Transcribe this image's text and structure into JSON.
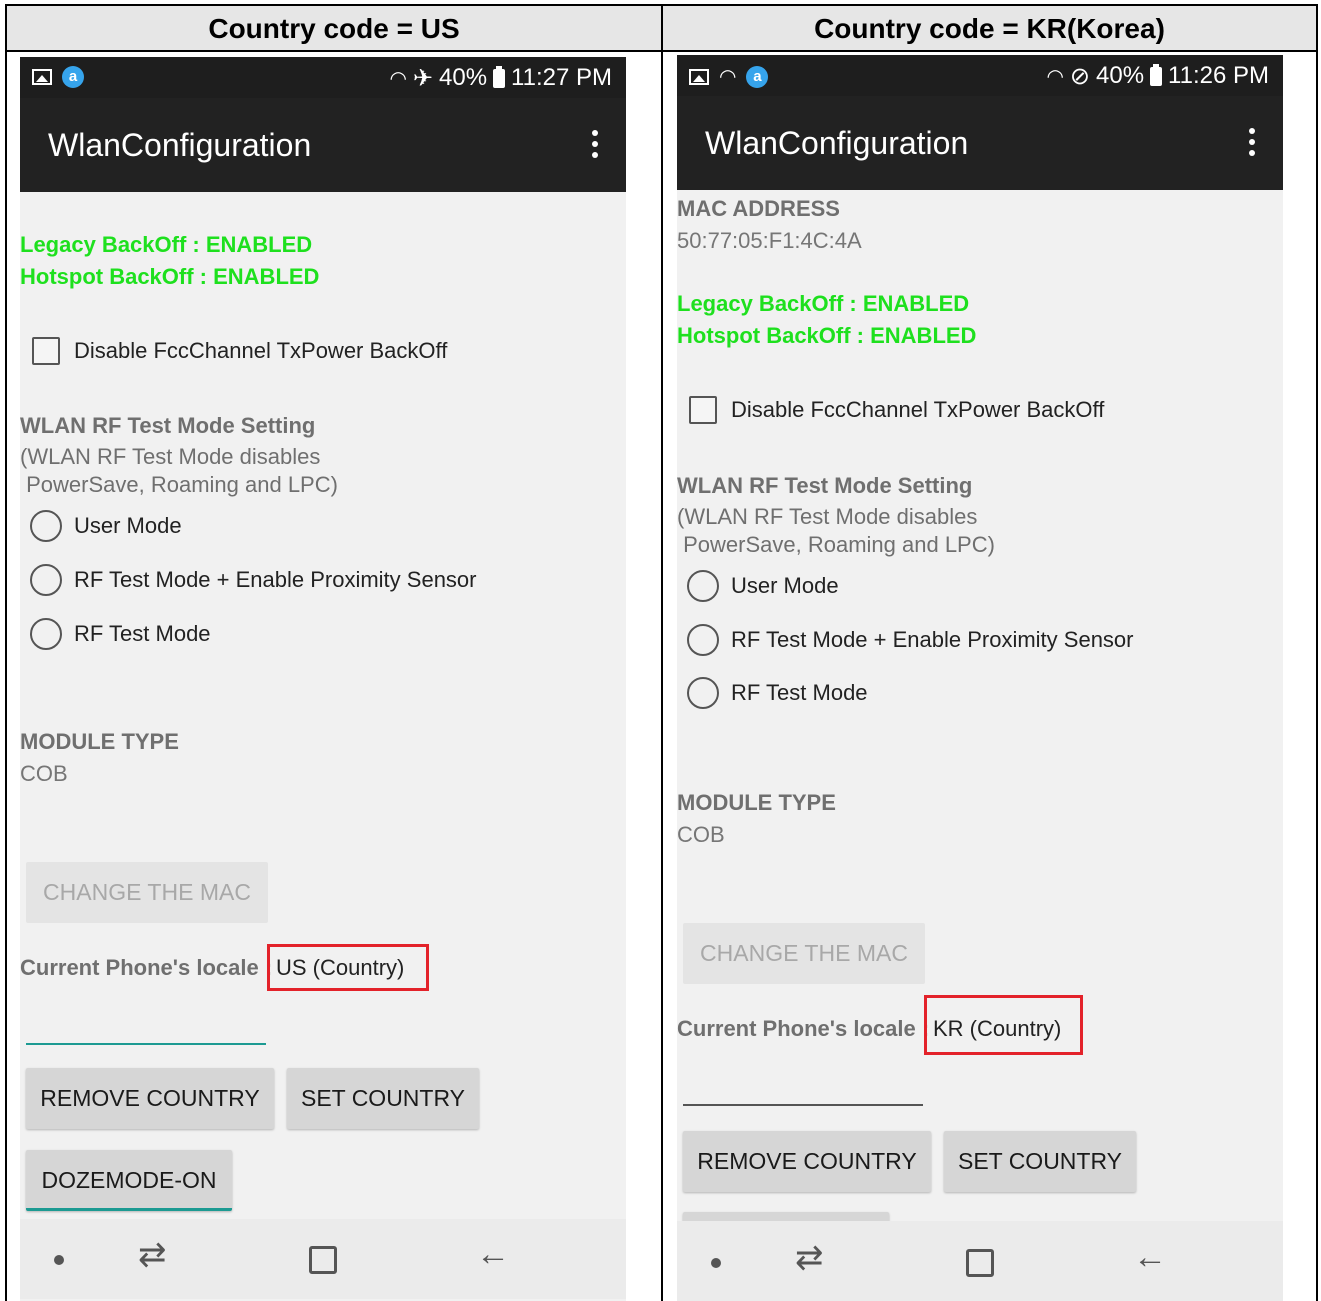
{
  "headers": {
    "left": "Country code = US",
    "right": "Country code = KR(Korea)"
  },
  "left_phone": {
    "status": {
      "battery": "40%",
      "time": "11:27 PM"
    },
    "app_title": "WlanConfiguration",
    "legacy_backoff": "Legacy BackOff : ENABLED",
    "hotspot_backoff": "Hotspot BackOff : ENABLED",
    "disable_fcc_label": "Disable FccChannel TxPower BackOff",
    "rf_mode_title": "WLAN RF Test Mode Setting",
    "rf_mode_note_1": "(WLAN RF Test Mode disables",
    "rf_mode_note_2": " PowerSave, Roaming and LPC)",
    "radio_user": "User Mode",
    "radio_rf_prox": "RF Test Mode + Enable Proximity Sensor",
    "radio_rf": "RF Test Mode",
    "module_type_label": "MODULE TYPE",
    "module_type_value": "COB",
    "change_mac": "CHANGE THE MAC",
    "locale_label": "Current Phone's locale : ",
    "locale_value": "US (Country)",
    "remove_country": "REMOVE COUNTRY",
    "set_country": "SET COUNTRY",
    "dozemode": "DOZEMODE-ON"
  },
  "right_phone": {
    "status": {
      "battery": "40%",
      "time": "11:26 PM"
    },
    "app_title": "WlanConfiguration",
    "mac_label": "MAC ADDRESS",
    "mac_value": "50:77:05:F1:4C:4A",
    "legacy_backoff": "Legacy BackOff : ENABLED",
    "hotspot_backoff": "Hotspot BackOff : ENABLED",
    "disable_fcc_label": "Disable FccChannel TxPower BackOff",
    "rf_mode_title": "WLAN RF Test Mode Setting",
    "rf_mode_note_1": "(WLAN RF Test Mode disables",
    "rf_mode_note_2": " PowerSave, Roaming and LPC)",
    "radio_user": "User Mode",
    "radio_rf_prox": "RF Test Mode + Enable Proximity Sensor",
    "radio_rf": "RF Test Mode",
    "module_type_label": "MODULE TYPE",
    "module_type_value": "COB",
    "change_mac": "CHANGE THE MAC",
    "locale_label": "Current Phone's locale : ",
    "locale_value": "KR (Country)",
    "remove_country": "REMOVE COUNTRY",
    "set_country": "SET COUNTRY"
  },
  "colors": {
    "enabled_green": "#1ee01e",
    "highlight_red": "#e3222a",
    "edit_underline_active": "#1c9a92",
    "edit_underline_inactive": "#555555",
    "appbar": "#222222"
  },
  "icons": {
    "status_left": [
      "image-icon",
      "assistant-icon"
    ],
    "status_right_us": [
      "wifi-icon",
      "airplane-icon",
      "battery-icon"
    ],
    "status_right_kr": [
      "wifi-icon",
      "do-not-disturb-icon",
      "battery-icon"
    ],
    "app_menu": "overflow-menu-icon",
    "nav": [
      "home-dot-icon",
      "recent-apps-icon",
      "overview-icon",
      "back-icon"
    ]
  }
}
